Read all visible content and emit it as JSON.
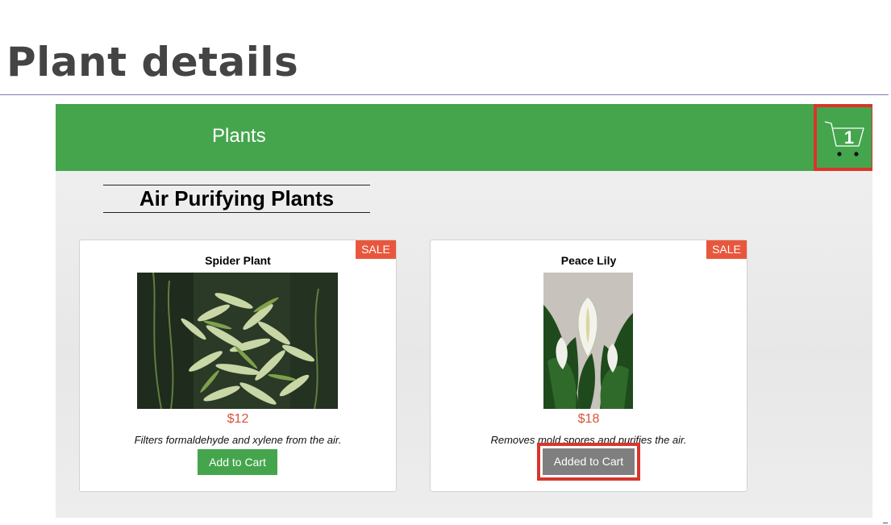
{
  "slide": {
    "title": "Plant details"
  },
  "header": {
    "title": "Plants",
    "cart_count": "1"
  },
  "section": {
    "heading": "Air Purifying Plants"
  },
  "products": [
    {
      "name": "Spider Plant",
      "badge": "SALE",
      "price": "$12",
      "description": "Filters formaldehyde and xylene from the air.",
      "button_label": "Add to Cart"
    },
    {
      "name": "Peace Lily",
      "badge": "SALE",
      "price": "$18",
      "description": "Removes mold spores and purifies the air.",
      "button_label": "Added to Cart"
    }
  ],
  "colors": {
    "header_green": "#45a54d",
    "sale_badge": "#e8573d",
    "price": "#d9533a",
    "highlight_border": "#d9352c",
    "added_button": "#7f7f7f"
  },
  "icons": {
    "cart": "cart-icon"
  }
}
